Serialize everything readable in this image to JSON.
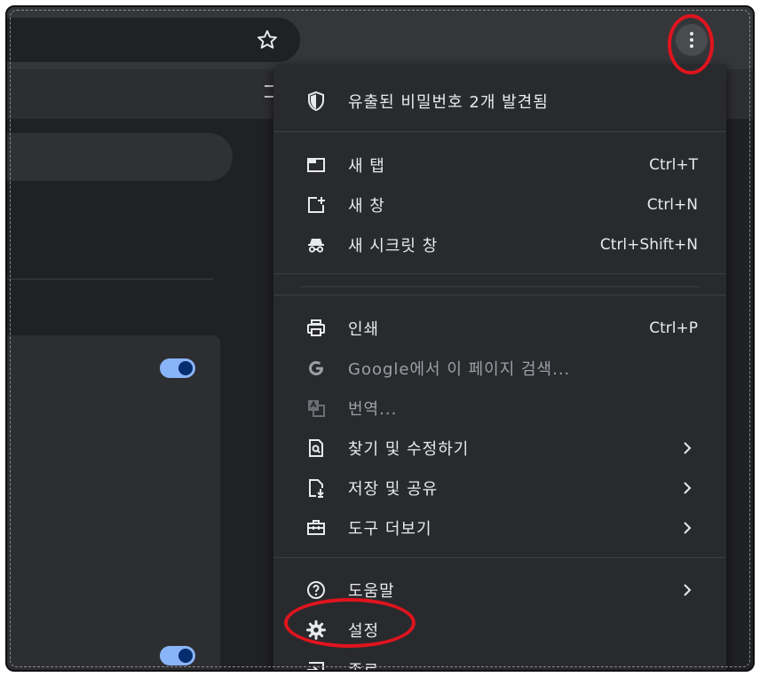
{
  "menu": {
    "password_alert": "유출된 비밀번호 2개 발견됨",
    "items": [
      {
        "label": "새 탭",
        "shortcut": "Ctrl+T"
      },
      {
        "label": "새 창",
        "shortcut": "Ctrl+N"
      },
      {
        "label": "새 시크릿 창",
        "shortcut": "Ctrl+Shift+N"
      },
      {
        "label": "인쇄",
        "shortcut": "Ctrl+P"
      },
      {
        "label": "Google에서 이 페이지 검색..."
      },
      {
        "label": "번역..."
      },
      {
        "label": "찾기 및 수정하기"
      },
      {
        "label": "저장 및 공유"
      },
      {
        "label": "도구 더보기"
      },
      {
        "label": "도움말"
      },
      {
        "label": "설정"
      },
      {
        "label": "종료"
      }
    ]
  },
  "icons": {
    "star": "star-icon",
    "menu": "more-vert-icon",
    "shield": "shield-icon",
    "new_tab": "tab-icon",
    "new_window": "new-window-icon",
    "incognito": "incognito-icon",
    "print": "print-icon",
    "google": "google-icon",
    "translate": "translate-icon",
    "find": "find-icon",
    "save": "save-share-icon",
    "tools": "toolbox-icon",
    "help": "help-icon",
    "settings": "gear-icon",
    "exit": "exit-icon"
  },
  "colors": {
    "menu_bg": "#292a2d",
    "text": "#e8eaed",
    "disabled_text": "#9aa0a6",
    "toggle_on": "#8ab4f8",
    "annotation": "#e0141e"
  }
}
